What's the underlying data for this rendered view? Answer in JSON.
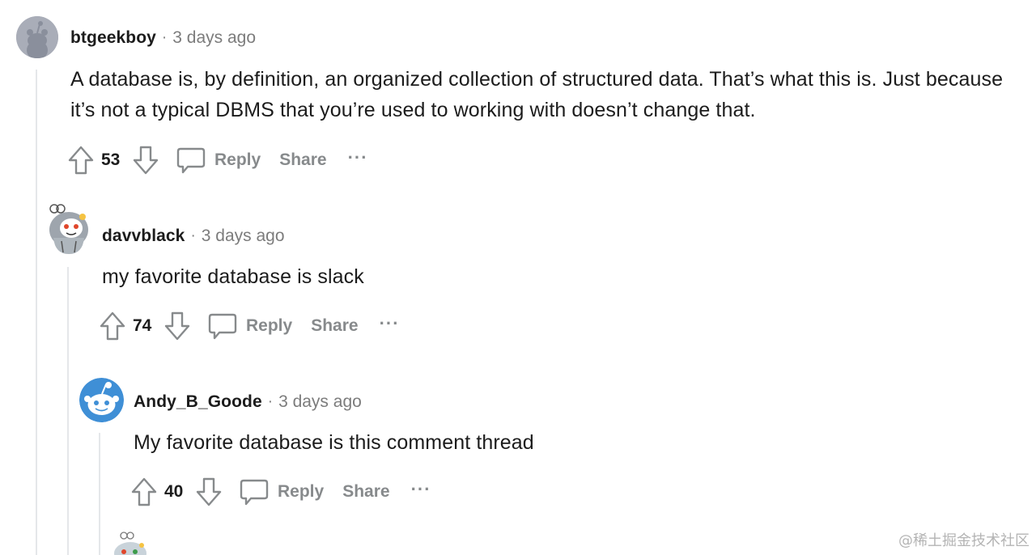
{
  "comments": [
    {
      "author": "btgeekboy",
      "separator": "·",
      "time": "3 days ago",
      "body": "A database is, by definition, an organized collection of structured data. That’s what this is. Just because it’s not a typical DBMS that you’re used to working with doesn’t change that.",
      "score": "53",
      "reply_label": "Reply",
      "share_label": "Share",
      "more_label": "···",
      "avatar_icon": "snoo-avatar-gray"
    },
    {
      "author": "davvblack",
      "separator": "·",
      "time": "3 days ago",
      "body": "my favorite database is slack",
      "score": "74",
      "reply_label": "Reply",
      "share_label": "Share",
      "more_label": "···",
      "avatar_icon": "snoo-avatar-gray-hood"
    },
    {
      "author": "Andy_B_Goode",
      "separator": "·",
      "time": "3 days ago",
      "body": "My favorite database is this comment thread",
      "score": "40",
      "reply_label": "Reply",
      "share_label": "Share",
      "more_label": "···",
      "avatar_icon": "snoo-avatar-blue"
    }
  ],
  "watermark": "@稀土掘金技术社区",
  "colors": {
    "text": "#1c1c1c",
    "meta": "#7c7c7c",
    "action": "#878a8c",
    "thread_line": "#e5e7ea",
    "avatar_blue": "#3f8fd6"
  }
}
